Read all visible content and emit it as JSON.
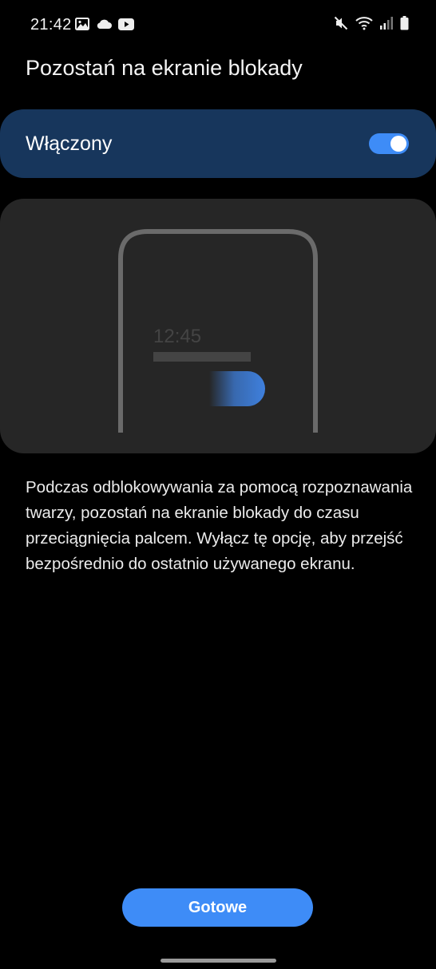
{
  "status_bar": {
    "time": "21:42",
    "left_icons": [
      "image-icon",
      "cloud-icon",
      "youtube-icon"
    ],
    "right_icons": [
      "mute-icon",
      "wifi-icon",
      "signal-icon",
      "battery-icon"
    ]
  },
  "page": {
    "title": "Pozostań na ekranie blokady"
  },
  "switch": {
    "label": "Włączony",
    "checked": true
  },
  "illustration": {
    "clock": "12:45"
  },
  "description": "Podczas odblokowywania za pomocą rozpoznawania twarzy, pozostań na ekranie blokady do czasu przeciągnięcia palcem. Wyłącz tę opcję, aby przejść bezpośrednio do ostatnio używanego ekranu.",
  "footer": {
    "done_label": "Gotowe"
  },
  "colors": {
    "background": "#000000",
    "switch_bar": "#17365c",
    "accent": "#3e8cf7",
    "illustration_bg": "#262626"
  }
}
